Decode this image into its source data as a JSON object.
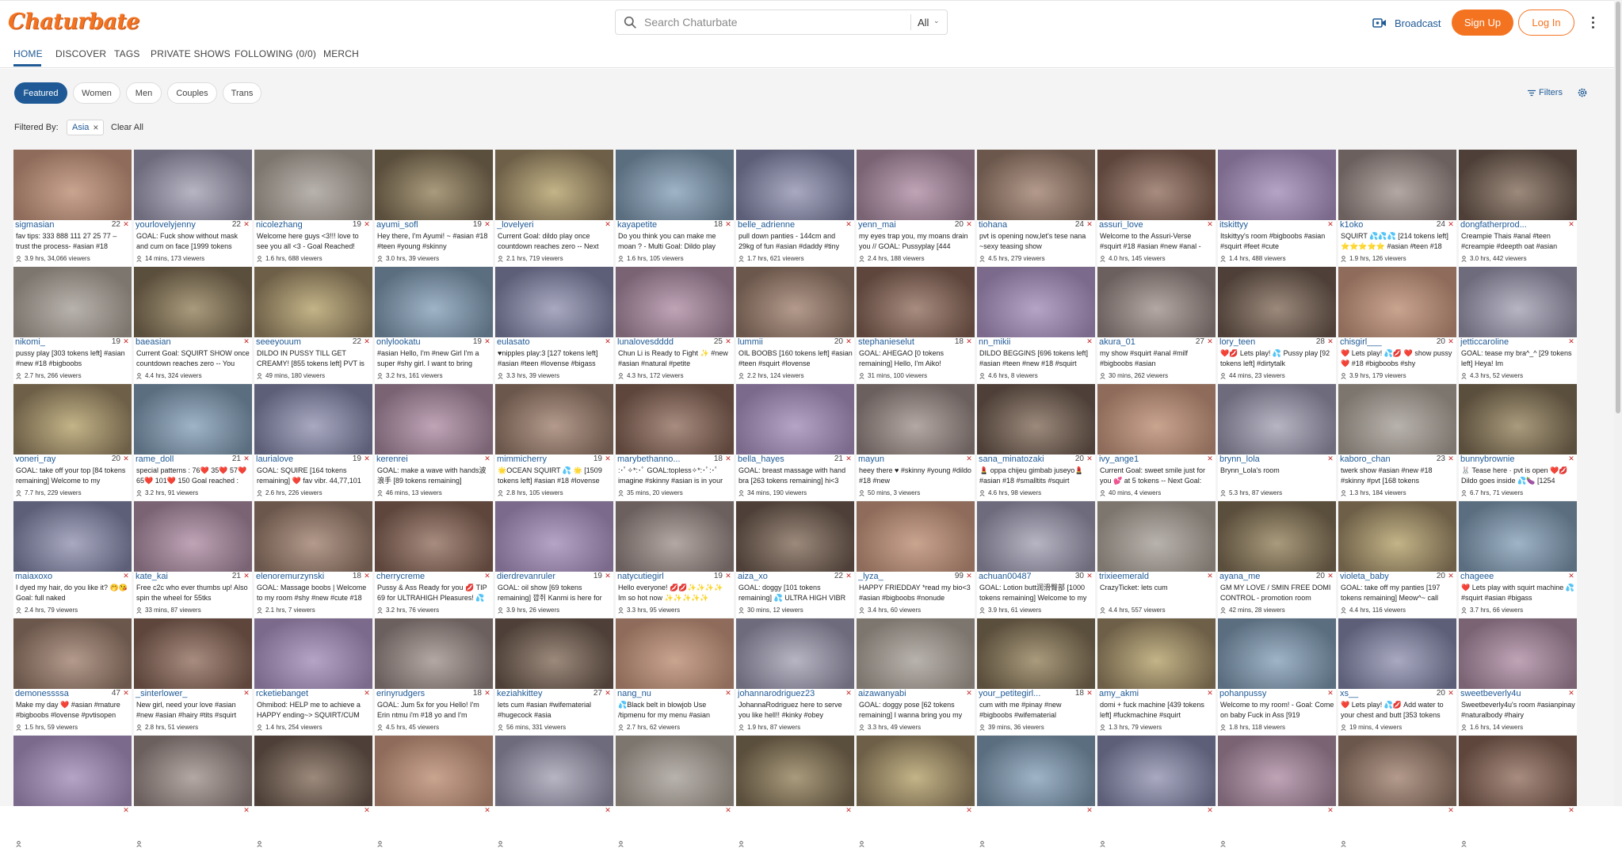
{
  "app": {
    "logo_text": "Chaturbate",
    "brand_color": "#f47321",
    "accent_color": "#1f5a96"
  },
  "search": {
    "placeholder": "Search Chaturbate",
    "scope": "All"
  },
  "header": {
    "broadcast_label": "Broadcast",
    "signup_label": "Sign Up",
    "login_label": "Log In"
  },
  "nav": {
    "tabs": [
      "HOME",
      "DISCOVER",
      "TAGS",
      "PRIVATE SHOWS",
      "FOLLOWING (0/0)",
      "MERCH"
    ],
    "active": "HOME"
  },
  "filters": {
    "categories": [
      "Featured",
      "Women",
      "Men",
      "Couples",
      "Trans"
    ],
    "active_category": "Featured",
    "filters_label": "Filters",
    "filtered_by_label": "Filtered By:",
    "active_tag": "Asia",
    "clear_all_label": "Clear All"
  },
  "rooms": [
    {
      "u": "sigmasian",
      "a": "22",
      "s": "fav tips: 333 888 111 27 25 77 – trust the process- #asian #18",
      "m": "3.9 hrs, 34,066 viewers"
    },
    {
      "u": "yourlovelyjenny",
      "a": "22",
      "s": "GOAL: Fuck show without mask and cum on face [1999 tokens",
      "m": "14 mins, 173 viewers"
    },
    {
      "u": "nicolezhang",
      "a": "19",
      "s": "Welcome here guys <3!!! love to see you all <3 - Goal Reached!",
      "m": "1.6 hrs, 688 viewers"
    },
    {
      "u": "ayumi_sofl",
      "a": "19",
      "s": "Hey there, I'm Ayumi! ~ #asian #18 #teen #young #skinny",
      "m": "3.0 hrs, 39 viewers"
    },
    {
      "u": "_lovelyeri",
      "a": "",
      "s": "Current Goal: dildo play once countdown reaches zero -- Next",
      "m": "2.1 hrs, 719 viewers"
    },
    {
      "u": "kayapetite",
      "a": "18",
      "s": "Do you think you can make me moan ? - Multi Goal: Dildo play",
      "m": "1.6 hrs, 105 viewers"
    },
    {
      "u": "belle_adrienne",
      "a": "",
      "s": "pull down panties - 144cm and 29kg of fun #asian #daddy #tiny",
      "m": "1.7 hrs, 621 viewers"
    },
    {
      "u": "yenn_mai",
      "a": "20",
      "s": "my eyes trap you, my moans drain you // GOAL: Pussyplay [444",
      "m": "2.4 hrs, 188 viewers"
    },
    {
      "u": "tiohana",
      "a": "24",
      "s": "pvt is opening now,let's tese nana ~sexy teasing show",
      "m": "4.5 hrs, 279 viewers"
    },
    {
      "u": "assuri_love",
      "a": "",
      "s": "Welcome to the Assuri-Verse #squirt #18 #asian #new #anal -",
      "m": "4.0 hrs, 145 viewers"
    },
    {
      "u": "itskittyy",
      "a": "",
      "s": "Itskittyy's room #bigboobs #asian #squirt #feet #cute",
      "m": "1.4 hrs, 488 viewers"
    },
    {
      "u": "k1oko",
      "a": "24",
      "s": "SQUIRT 💦💦💦 [214 tokens left] ⭐⭐⭐⭐⭐ #asian #teen #18",
      "m": "1.9 hrs, 126 viewers"
    },
    {
      "u": "dongfatherprod...",
      "a": "",
      "s": "Creampie Thais #anal #teen #creampie #deepth oat #asian",
      "m": "3.0 hrs, 442 viewers"
    },
    {
      "u": "nikomi_",
      "a": "19",
      "s": "pussy play [303 tokens left] #asian #new #18 #bigboobs",
      "m": "2.7 hrs, 266 viewers"
    },
    {
      "u": "baeasian",
      "a": "",
      "s": "Current Goal: SQUIRT SHOW once countdown reaches zero -- You",
      "m": "4.4 hrs, 324 viewers"
    },
    {
      "u": "seeeyouum",
      "a": "22",
      "s": "DILDO IN PUSSY TILL GET CREAMY! [855 tokens left] PVT is",
      "m": "49 mins, 180 viewers"
    },
    {
      "u": "onlylookatu",
      "a": "19",
      "s": "#asian Hello, I'm #new Girl I'm a super #shy girl. I want to bring",
      "m": "3.2 hrs, 161 viewers"
    },
    {
      "u": "eulasato",
      "a": "",
      "s": "♥nipples play:3 [127 tokens left] #asian #teen #lovense #bigass",
      "m": "3.3 hrs, 39 viewers"
    },
    {
      "u": "lunalovesdddd",
      "a": "25",
      "s": "Chun Li is Ready to Fight ✨ #new #asian #natural #petite",
      "m": "4.3 hrs, 172 viewers"
    },
    {
      "u": "lummii",
      "a": "20",
      "s": "OIL BOOBS [160 tokens left] #asian #teen #squirt #lovense",
      "m": "2.2 hrs, 124 viewers"
    },
    {
      "u": "stephanieselut",
      "a": "18",
      "s": "GOAL: AHEGAO [0 tokens remaining] Hello, I'm Aiko!",
      "m": "31 mins, 100 viewers"
    },
    {
      "u": "nn_mikii",
      "a": "",
      "s": "DILDO BEGGINS [696 tokens left] #asian #teen #new #18 #squirt",
      "m": "4.6 hrs, 8 viewers"
    },
    {
      "u": "akura_01",
      "a": "27",
      "s": "my show #squirt #anal #milf #bigboobs #asian",
      "m": "30 mins, 262 viewers"
    },
    {
      "u": "lory_teen",
      "a": "28",
      "s": "❤️💋 Lets play! 💦 Pussy play [92 tokens left] #dirtytalk",
      "m": "44 mins, 23 viewers"
    },
    {
      "u": "chisgirl___",
      "a": "20",
      "s": "❤️ Lets play! 💦💋 ❤️ show pussy ❤️ #18 #bigboobs #shy",
      "m": "3.9 hrs, 179 viewers"
    },
    {
      "u": "jetticcaroline",
      "a": "",
      "s": "GOAL: tease my bra^_^ [29 tokens left] Heya! Im",
      "m": "4.3 hrs, 52 viewers"
    },
    {
      "u": "voneri_ray",
      "a": "20",
      "s": "GOAL: take off your top [84 tokens remaining] Welcome to my",
      "m": "7.7 hrs, 229 viewers"
    },
    {
      "u": "rame_doll",
      "a": "21",
      "s": "special patterns : 76❤️ 35❤️ 57❤️ 65❤️ 101❤️ 150 Goal reached :",
      "m": "3.2 hrs, 91 viewers"
    },
    {
      "u": "laurialove",
      "a": "19",
      "s": "GOAL: SQUIRE [164 tokens remaining] ❤️ fav vibr. 44,77,101",
      "m": "2.6 hrs, 226 viewers"
    },
    {
      "u": "kerenrei",
      "a": "",
      "s": "GOAL: make a wave with hands波浪手 [89 tokens remaining]",
      "m": "46 mins, 13 viewers"
    },
    {
      "u": "mimmicherry",
      "a": "19",
      "s": "🌟OCEAN SQUIRT 💦 🌟 [1509 tokens left] #asian #18 #lovense",
      "m": "2.8 hrs, 105 viewers"
    },
    {
      "u": "marybethanno...",
      "a": "18",
      "s": ":･ﾟ✧*:･ﾟ GOAL:topless✧*:･ﾟ:･ﾟ imagine #skinny #asian is in your",
      "m": "35 mins, 20 viewers"
    },
    {
      "u": "bella_hayes",
      "a": "21",
      "s": "GOAL: breast massage with hand bra [263 tokens remaining] hi<3",
      "m": "34 mins, 190 viewers"
    },
    {
      "u": "mayun",
      "a": "",
      "s": "heey there ♥ #skinny #young #dildo #18 #new",
      "m": "50 mins, 3 viewers"
    },
    {
      "u": "sana_minatozaki",
      "a": "20",
      "s": "💄 oppa chijeu gimbab juseyo💄 #asian #18 #smalltits #squirt",
      "m": "4.6 hrs, 98 viewers"
    },
    {
      "u": "ivy_ange1",
      "a": "",
      "s": "Current Goal: sweet smile just for you 💕 at 5 tokens -- Next Goal:",
      "m": "40 mins, 4 viewers"
    },
    {
      "u": "brynn_lola",
      "a": "",
      "s": "Brynn_Lola's room",
      "m": "5.3 hrs, 87 viewers"
    },
    {
      "u": "kaboro_chan",
      "a": "23",
      "s": "twerk show #asian #new #18 #skinny #pvt [168 tokens",
      "m": "1.3 hrs, 184 viewers"
    },
    {
      "u": "bunnybrownie",
      "a": "",
      "s": "🐰 Tease here · pvt is open ❤️💋 Dildo goes inside 💦🍆 [1254",
      "m": "6.7 hrs, 71 viewers"
    },
    {
      "u": "maiaxoxo",
      "a": "",
      "s": "I dyed my hair, do you like it? 🤭😘 Goal: full naked",
      "m": "2.4 hrs, 79 viewers"
    },
    {
      "u": "kate_kai",
      "a": "21",
      "s": "Free c2c who ever thumbs up! Also spin the wheel for 55tks",
      "m": "33 mins, 87 viewers"
    },
    {
      "u": "elenoremurzynski",
      "a": "18",
      "s": "GOAL: Massage boobs | Welcome to my room #shy #new #cute #18",
      "m": "2.1 hrs, 7 viewers"
    },
    {
      "u": "cherrycreme",
      "a": "",
      "s": "Pussy & Ass Ready for you 💋 TIP 69 for ULTRAHIGH Pleasures! 💦",
      "m": "3.2 hrs, 76 viewers"
    },
    {
      "u": "dierdrevanruler",
      "a": "19",
      "s": "GOAL: oil show [69 tokens remaining] 깝쥐 Kanmi is here for",
      "m": "3.9 hrs, 26 viewers"
    },
    {
      "u": "natycutiegirl",
      "a": "19",
      "s": "Hello everyone! 💋💋✨✨✨✨ Im so hot now ✨✨✨✨✨",
      "m": "3.3 hrs, 95 viewers"
    },
    {
      "u": "aiza_xo",
      "a": "22",
      "s": "GOAL: doggy [101 tokens remaining] 💦 ULTRA HIGH VIBR",
      "m": "30 mins, 12 viewers"
    },
    {
      "u": "_lyza_",
      "a": "99",
      "s": "HAPPY FRIEDDAY *read my bio<3 #asian #bigboobs #nonude",
      "m": "3.4 hrs, 60 viewers"
    },
    {
      "u": "achuan00487",
      "a": "30",
      "s": "GOAL: Lotion butt润滑臀部 [1000 tokens remaining] Welcome to my",
      "m": "3.9 hrs, 61 viewers"
    },
    {
      "u": "trixieemerald",
      "a": "",
      "s": "CrazyTicket: lets cum",
      "m": "4.4 hrs, 557 viewers"
    },
    {
      "u": "ayana_me",
      "a": "20",
      "s": "GM MY LOVE / SMIN FREE DOMI CONTROL - promotion room",
      "m": "42 mins, 28 viewers"
    },
    {
      "u": "violeta_baby",
      "a": "20",
      "s": "GOAL: take off my panties [197 tokens remaining] Meow^~ call",
      "m": "4.4 hrs, 116 viewers"
    },
    {
      "u": "chageee",
      "a": "",
      "s": "❤️ Lets play with squirt machine 💦 #squirt #asian #bigass",
      "m": "3.7 hrs, 66 viewers"
    },
    {
      "u": "demonessssa",
      "a": "47",
      "s": "Make my day ❤️ #asian #mature #bigboobs #lovense #pvtisopen",
      "m": "1.5 hrs, 59 viewers"
    },
    {
      "u": "_sinterlower_",
      "a": "",
      "s": "New girl, need your love #asian #new #asian #hairy #tits #squirt",
      "m": "2.8 hrs, 51 viewers"
    },
    {
      "u": "rcketiebanget",
      "a": "",
      "s": "Ohmibod: HELP me to achieve a HAPPY ending~> SQUIRT/CUM",
      "m": "1.4 hrs, 254 viewers"
    },
    {
      "u": "erinyrudgers",
      "a": "18",
      "s": "GOAL: Jum 5x for you Hello! I'm Erin ntmu i'm #18 yo and I'm",
      "m": "4.5 hrs, 45 viewers"
    },
    {
      "u": "keziahkittey",
      "a": "27",
      "s": "lets cum #asian #wifematerial #hugecock #asia",
      "m": "56 mins, 331 viewers"
    },
    {
      "u": "nang_nu",
      "a": "",
      "s": "💦Black belt in blowjob Use /tipmenu for my menu #asian",
      "m": "2.7 hrs, 62 viewers"
    },
    {
      "u": "johannarodriguez23",
      "a": "",
      "s": "JohannaRodriguez here to serve you like hell!! #kinky #obey",
      "m": "1.9 hrs, 87 viewers"
    },
    {
      "u": "aizawanyabi",
      "a": "",
      "s": "GOAL: doggy pose [62 tokens remaining] I wanna bring you my",
      "m": "3.3 hrs, 49 viewers"
    },
    {
      "u": "your_petitegirl...",
      "a": "18",
      "s": "cum with me #pinay #new #bigboobs #wifematerial",
      "m": "39 mins, 36 viewers"
    },
    {
      "u": "amy_akmi",
      "a": "",
      "s": "domi + fuck machine [439 tokens left] #fuckmachine #squirt",
      "m": "1.3 hrs, 79 viewers"
    },
    {
      "u": "pohanpussy",
      "a": "",
      "s": "Welcome to my room! - Goal: Come on baby Fuck in Ass [919",
      "m": "1.8 hrs, 118 viewers"
    },
    {
      "u": "xs__",
      "a": "20",
      "s": "❤️ Lets play! 💦💋 Add water to your chest and butt [353 tokens",
      "m": "19 mins, 4 viewers"
    },
    {
      "u": "sweetbeverly4u",
      "a": "",
      "s": "Sweetbeverly4u's room #asianpinay #naturalbody #hairy",
      "m": "1.6 hrs, 14 viewers"
    },
    {
      "u": "",
      "a": "",
      "s": "",
      "m": ""
    },
    {
      "u": "",
      "a": "",
      "s": "",
      "m": ""
    },
    {
      "u": "",
      "a": "",
      "s": "",
      "m": ""
    },
    {
      "u": "",
      "a": "",
      "s": "",
      "m": ""
    },
    {
      "u": "",
      "a": "",
      "s": "",
      "m": ""
    },
    {
      "u": "",
      "a": "",
      "s": "",
      "m": ""
    },
    {
      "u": "",
      "a": "",
      "s": "",
      "m": ""
    },
    {
      "u": "",
      "a": "",
      "s": "",
      "m": ""
    },
    {
      "u": "",
      "a": "",
      "s": "",
      "m": ""
    },
    {
      "u": "",
      "a": "",
      "s": "",
      "m": ""
    },
    {
      "u": "",
      "a": "",
      "s": "",
      "m": ""
    },
    {
      "u": "",
      "a": "",
      "s": "",
      "m": ""
    },
    {
      "u": "",
      "a": "",
      "s": "",
      "m": ""
    }
  ]
}
